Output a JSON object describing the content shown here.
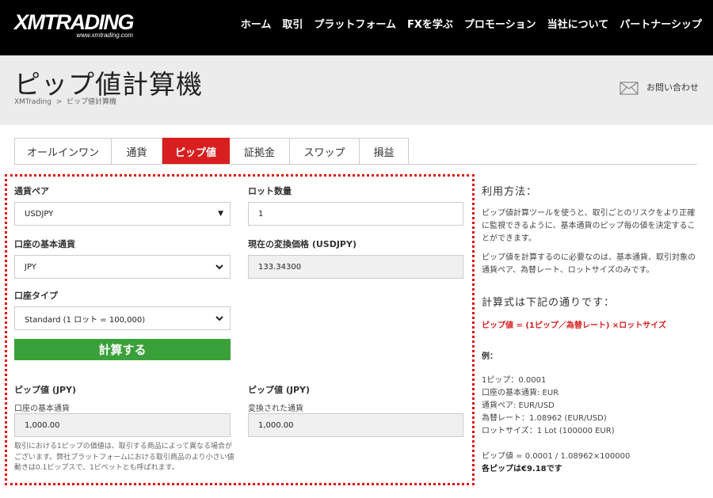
{
  "header": {
    "logo_text": "XMTRADING",
    "logo_url_text": "www.xmtrading.com",
    "nav": [
      "ホーム",
      "取引",
      "プラットフォーム",
      "FXを学ぶ",
      "プロモーション",
      "当社について",
      "パートナーシップ"
    ]
  },
  "titleband": {
    "title": "ピップ値計算機",
    "breadcrumb": [
      "XMTrading",
      "ピップ値計算機"
    ],
    "contact_label": "お問い合わせ"
  },
  "tabs": [
    {
      "label": "オールインワン",
      "active": false
    },
    {
      "label": "通貨",
      "active": false
    },
    {
      "label": "ピップ値",
      "active": true
    },
    {
      "label": "証拠金",
      "active": false
    },
    {
      "label": "スワップ",
      "active": false
    },
    {
      "label": "損益",
      "active": false
    }
  ],
  "form": {
    "pair_label": "通貨ペア",
    "pair_value": "USDJPY",
    "lots_label": "ロット数量",
    "lots_value": "1",
    "base_label": "口座の基本通貨",
    "base_value": "JPY",
    "rate_label": "現在の変換価格 (USDJPY)",
    "rate_value": "133.34300",
    "account_type_label": "口座タイプ",
    "account_type_value": "Standard (1 ロット = 100,000)",
    "calc_button": "計算する"
  },
  "results": {
    "left_title": "ピップ値 (JPY)",
    "left_sub": "口座の基本通貨",
    "left_value": "1,000.00",
    "right_title": "ピップ値 (JPY)",
    "right_sub": "変換された通貨",
    "right_value": "1,000.00",
    "note": "取引における1ピップの価値は、取引する商品によって異なる場合がございます。弊社プラットフォームにおける取引商品のより小さい値動きは0.1ピップスで、1ピペットとも呼ばれます。"
  },
  "info": {
    "usage_title": "利用方法：",
    "para1": "ピップ値計算ツールを使うと、取引ごとのリスクをより正確に監視できるように、基本通貨のピップ毎の値を決定することができます。",
    "para2": "ピップ値を計算するのに必要なのは、基本通貨、取引対象の通貨ペア、為替レート、ロットサイズのみです。",
    "formula_title": "計算式は下記の通りです：",
    "formula": "ピップ値 = (1ピップ／為替レート) ×ロットサイズ",
    "example_title": "例：",
    "example_lines": [
      "1ピップ：0.0001",
      "口座の基本通貨: EUR",
      "通貨ペア: EUR/USD",
      "為替レート：1.08962 (EUR/USD)",
      "ロットサイズ：1 Lot (100000 EUR)"
    ],
    "result_line": "ピップ値 = 0.0001 / 1.08962×100000",
    "result_bold": "各ピップは€9.18です"
  },
  "colors": {
    "brand_red": "#d81e1e",
    "button_green": "#3aa13a",
    "header_black": "#000000"
  }
}
